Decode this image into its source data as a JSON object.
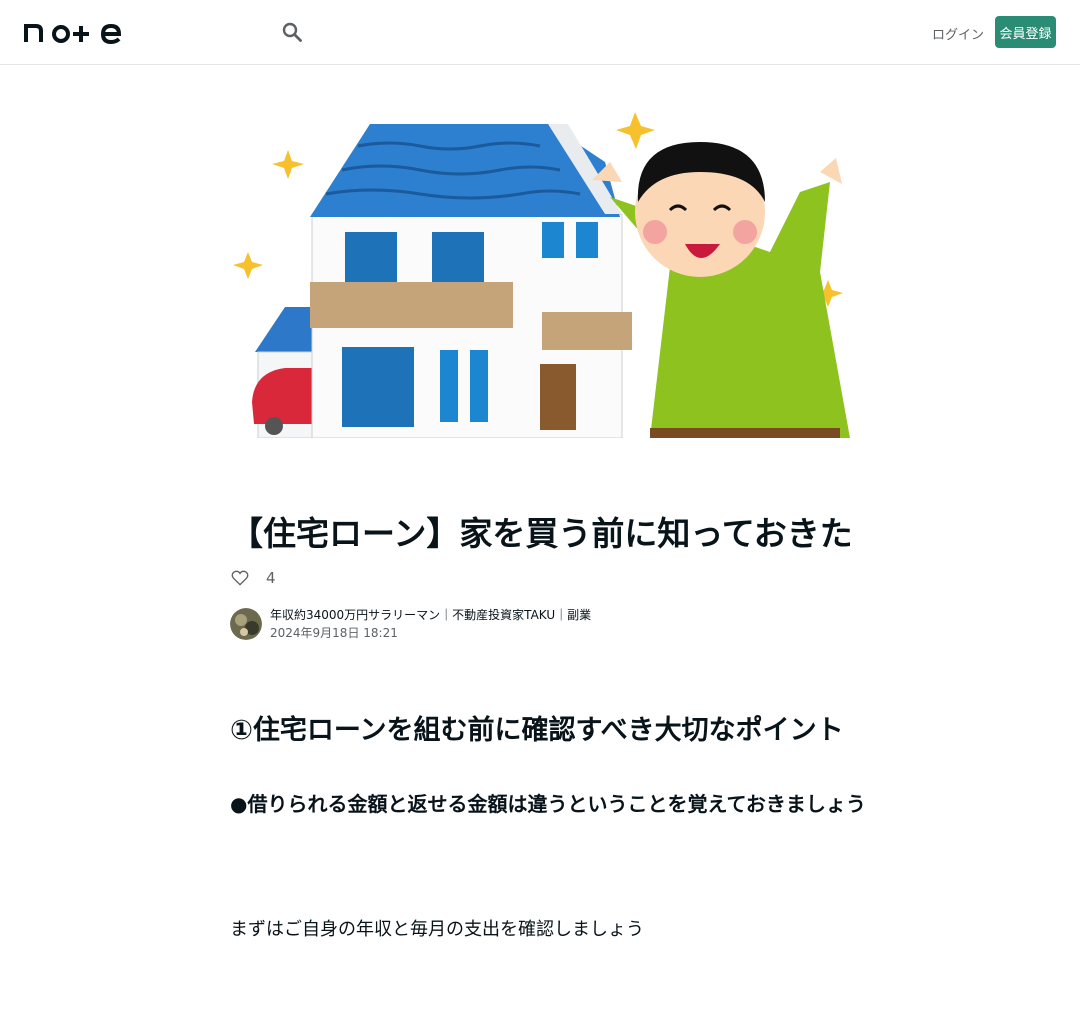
{
  "header": {
    "logo_text": "note",
    "search_icon": "search-icon",
    "login_label": "ログイン",
    "signup_label": "会員登録"
  },
  "article": {
    "hero_image": "illustration-new-house-happy-man",
    "title": "【住宅ローン】家を買う前に知っておきたいお金の話【必読】",
    "like_icon": "heart-outline-icon",
    "like_count": "4",
    "author_name": "年収約34000万円サラリーマン｜不動産投資家TAKU｜副業",
    "post_date": "2024年9月18日 18:21",
    "heading": "①住宅ローンを組む前に確認すべき大切なポイント",
    "bullet": "●借りられる金額と返せる金額は違うということを覚えておきましょう",
    "paragraph": "まずはご自身の年収と毎月の支出を確認しましょう"
  },
  "colors": {
    "brand": "#2a8c74",
    "text": "#08131a",
    "muted": "#5b6165",
    "border": "#e3e5e6"
  }
}
